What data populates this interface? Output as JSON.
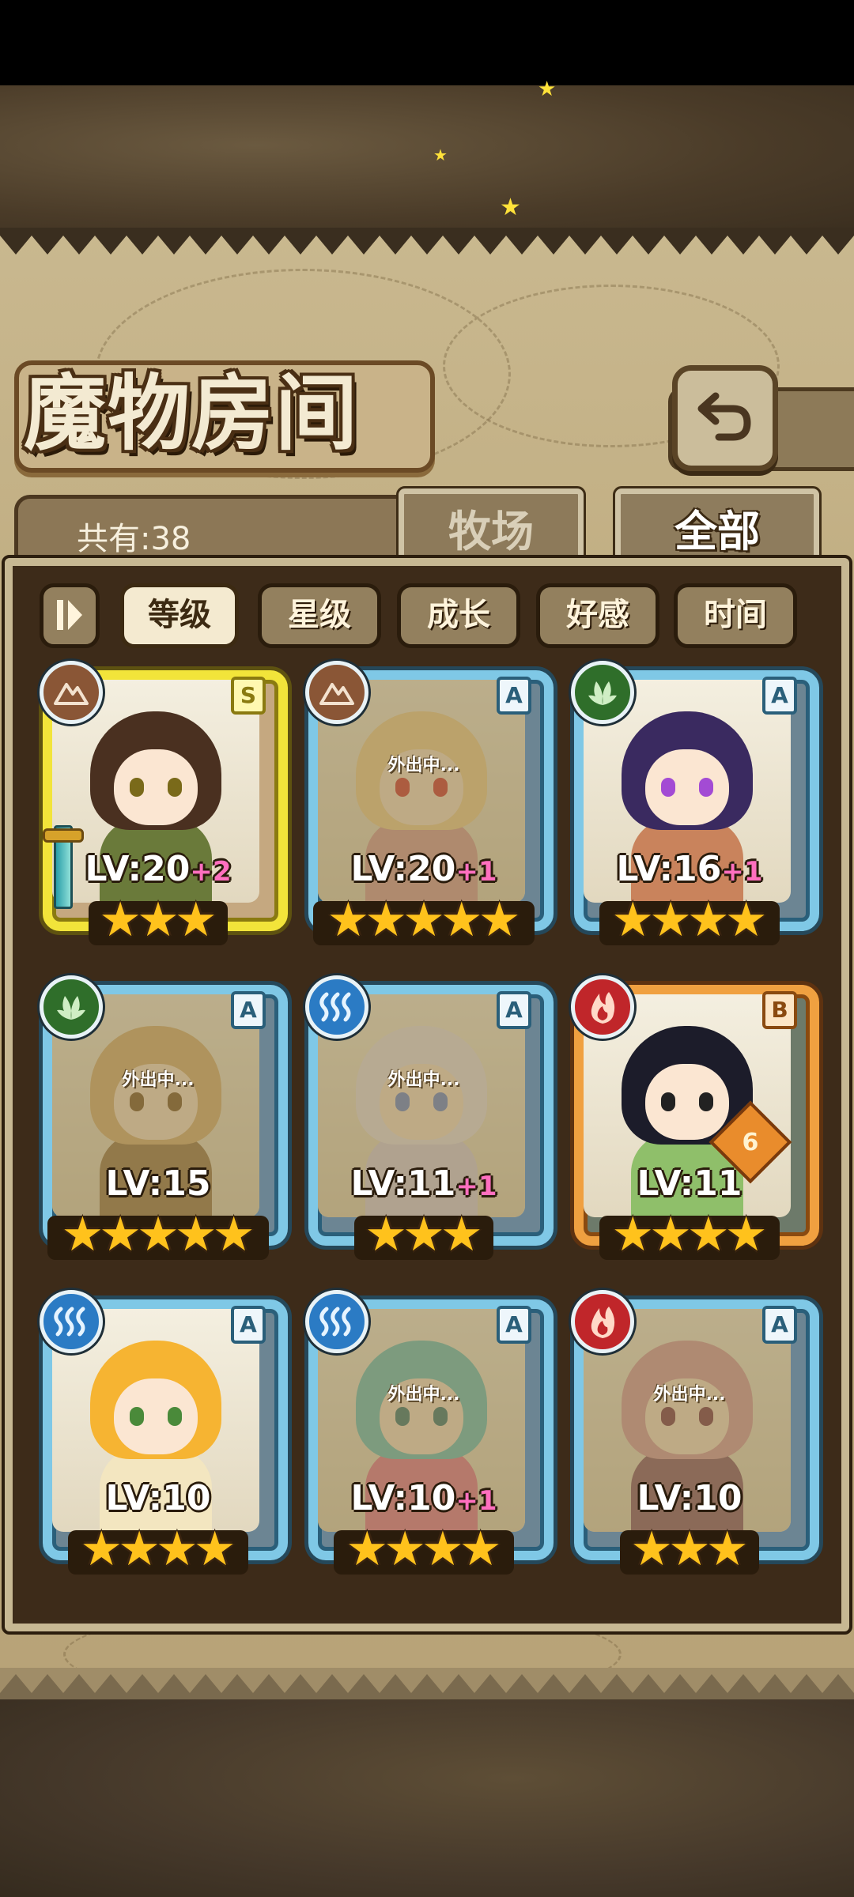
{
  "header": {
    "title": "魔物房间",
    "back_icon": "return-arrow-icon"
  },
  "tabs": {
    "count_label": "共有:38",
    "farm_label": "牧场",
    "all_label": "全部",
    "active": "all"
  },
  "filters": {
    "order_icon": "sort-order-icon",
    "items": [
      {
        "label": "等级",
        "active": true
      },
      {
        "label": "星级",
        "active": false
      },
      {
        "label": "成长",
        "active": false
      },
      {
        "label": "好感",
        "active": false
      },
      {
        "label": "时间",
        "active": false
      }
    ]
  },
  "monsters": [
    {
      "rank": "S",
      "element": "earth-icon",
      "level": "LV:20",
      "bonus": "+2",
      "stars": 3,
      "away": "",
      "hair": "#4a3020",
      "outfit": "#6a7a3a",
      "eyes": "#7a6a1a"
    },
    {
      "rank": "A",
      "element": "earth-icon",
      "level": "LV:20",
      "bonus": "+1",
      "stars": 5,
      "away": "外出中...",
      "hair": "#f3d49a",
      "outfit": "#d9a0a0",
      "eyes": "#d23a3a"
    },
    {
      "rank": "A",
      "element": "grass-icon",
      "level": "LV:16",
      "bonus": "+1",
      "stars": 4,
      "away": "",
      "hair": "#3a2a60",
      "outfit": "#c9835c",
      "eyes": "#a34bd4"
    },
    {
      "rank": "A",
      "element": "grass-icon",
      "level": "LV:15",
      "bonus": "",
      "stars": 5,
      "away": "外出中...",
      "hair": "#d9b47a",
      "outfit": "#9a7a50",
      "eyes": "#7a5a30"
    },
    {
      "rank": "A",
      "element": "water-icon",
      "level": "LV:11",
      "bonus": "+1",
      "stars": 3,
      "away": "外出中...",
      "hair": "#eae6f0",
      "outfit": "#dcd6e8",
      "eyes": "#6a8ad4"
    },
    {
      "rank": "B",
      "element": "fire-icon",
      "level": "LV:11",
      "bonus": "",
      "stars": 4,
      "away": "",
      "hair": "#1c1c2a",
      "outfit": "#8fbf6a",
      "eyes": "#222222",
      "badge": "6"
    },
    {
      "rank": "A",
      "element": "water-icon",
      "level": "LV:10",
      "bonus": "",
      "stars": 4,
      "away": "",
      "hair": "#f6b432",
      "outfit": "#f3e6c0",
      "eyes": "#4a8a3a"
    },
    {
      "rank": "A",
      "element": "water-icon",
      "level": "LV:10",
      "bonus": "+1",
      "stars": 4,
      "away": "外出中...",
      "hair": "#6ac6c4",
      "outfit": "#e67a9a",
      "eyes": "#3a7a7a"
    },
    {
      "rank": "A",
      "element": "fire-icon",
      "level": "LV:10",
      "bonus": "",
      "stars": 3,
      "away": "外出中...",
      "hair": "#d9a0a8",
      "outfit": "#8a5a70",
      "eyes": "#7a3a50"
    }
  ]
}
